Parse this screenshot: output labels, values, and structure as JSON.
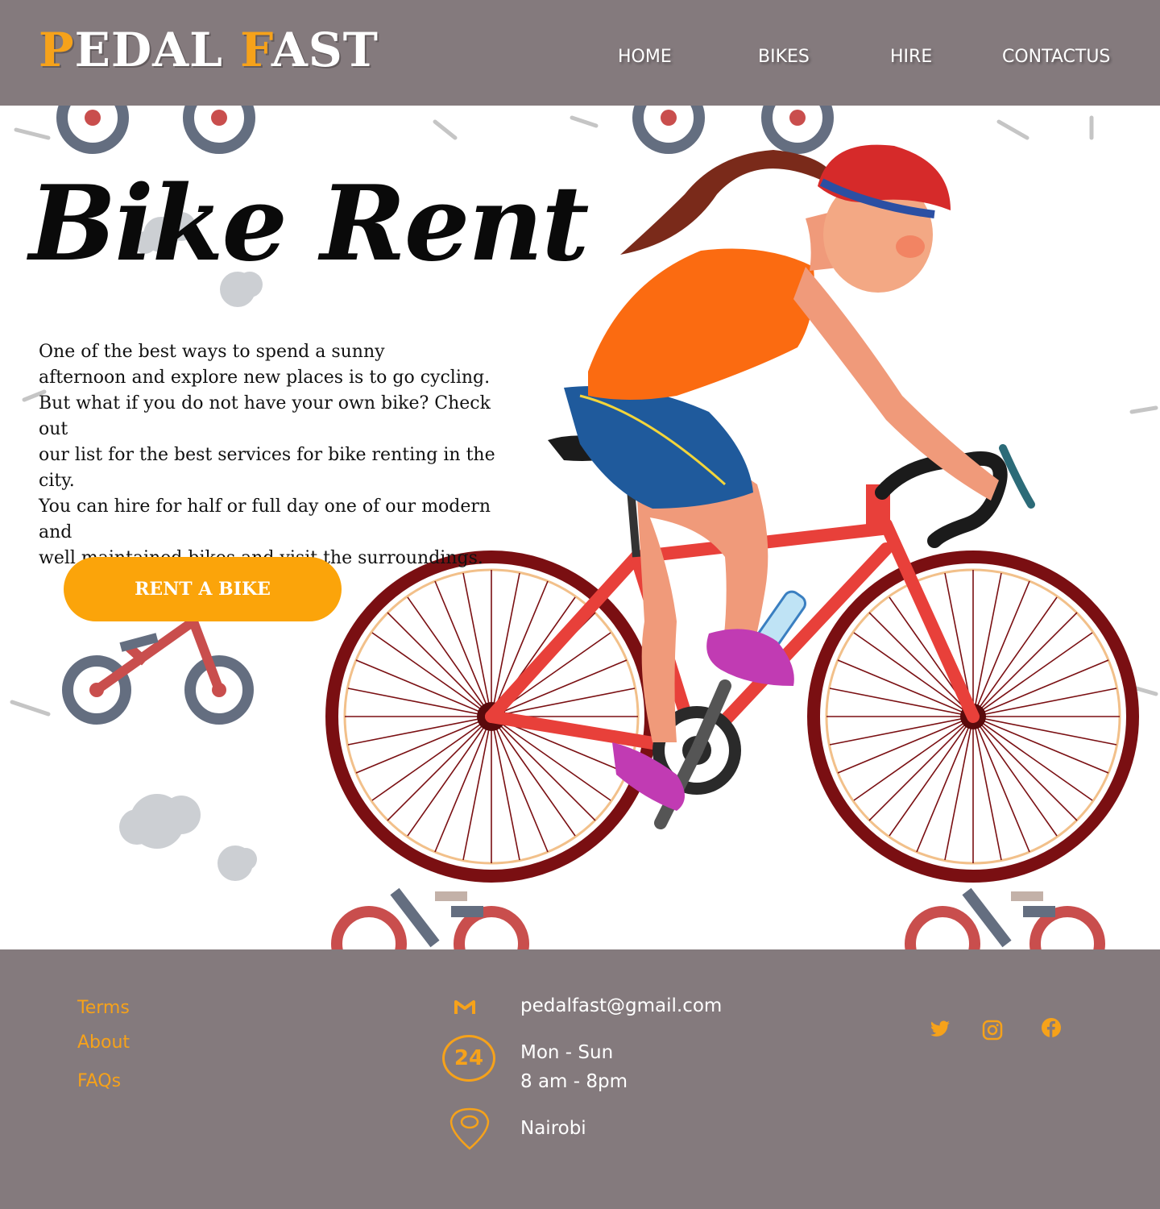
{
  "header": {
    "logo": {
      "part1": "P",
      "part2": "EDAL ",
      "part3": "F",
      "part4": "AST"
    },
    "nav": [
      {
        "label": "HOME"
      },
      {
        "label": "BIKES"
      },
      {
        "label": "HIRE"
      },
      {
        "label": "CONTACTUS"
      }
    ]
  },
  "hero": {
    "title": "Bike Rent",
    "description": "One of the best ways to spend a sunny\nafternoon and explore new places is to go cycling.\nBut what if you do not have your own bike? Check out\nour list for the best services for bike renting in the city.\nYou can hire for half or full day one of our modern and\nwell maintained  bikes and visit the surroundings.",
    "button_label": "RENT A BIKE"
  },
  "footer": {
    "links": [
      {
        "label": "Terms"
      },
      {
        "label": "About"
      },
      {
        "label": "FAQs"
      }
    ],
    "contact": {
      "email": "pedalfast@gmail.com",
      "hours": "Mon - Sun\n8 am -  8pm",
      "location": "Nairobi",
      "hours_icon_text": "24"
    },
    "social": [
      "twitter-icon",
      "instagram-icon",
      "facebook-icon"
    ]
  },
  "colors": {
    "header_bg": "#847a7d",
    "accent": "#f6a21a",
    "button": "#fba40a",
    "footer_bg": "#847a7d"
  }
}
